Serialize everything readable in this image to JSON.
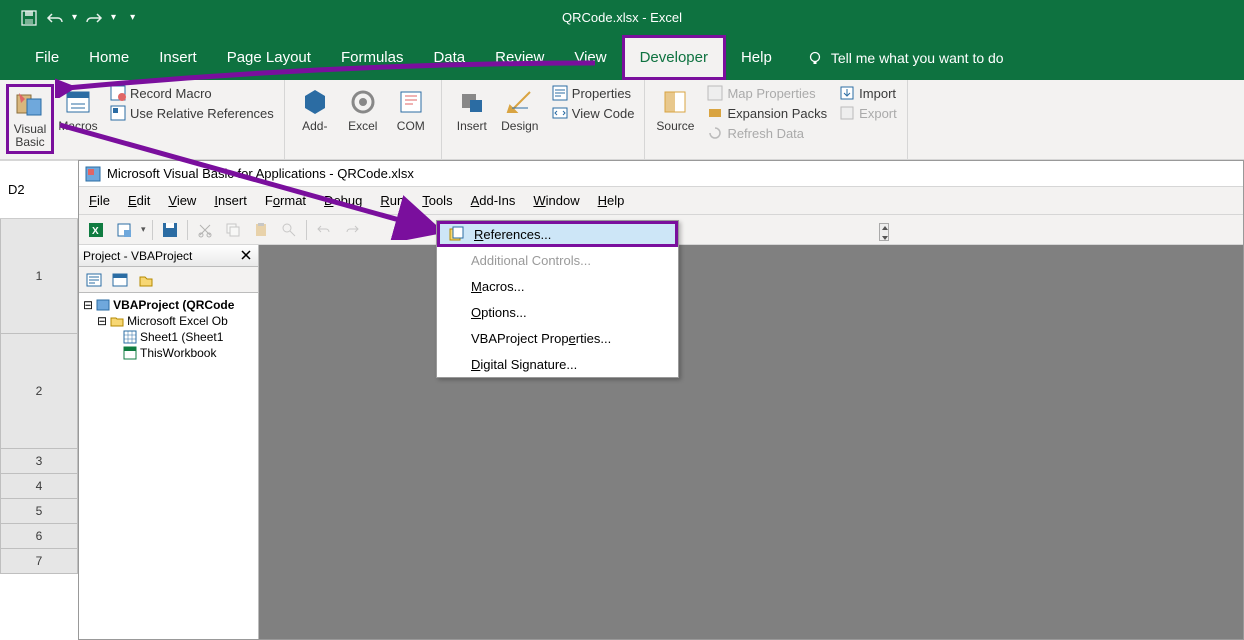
{
  "app": {
    "title": "QRCode.xlsx  -  Excel",
    "cell_ref": "D2"
  },
  "qat": {
    "save": "save",
    "undo": "undo",
    "redo": "redo"
  },
  "tabs": [
    "File",
    "Home",
    "Insert",
    "Page Layout",
    "Formulas",
    "Data",
    "Review",
    "View",
    "Developer",
    "Help"
  ],
  "tellme": "Tell me what you want to do",
  "ribbon": {
    "vb_label": "Visual\nBasic",
    "macros_label": "Macros",
    "record_macro": "Record Macro",
    "use_relative": "Use Relative References",
    "addins": "Add-",
    "excel_addins": "Excel",
    "com_addins": "COM",
    "insert": "Insert",
    "design": "Design",
    "properties": "Properties",
    "view_code": "View Code",
    "source": "Source",
    "map_props": "Map Properties",
    "expansion": "Expansion Packs",
    "refresh": "Refresh Data",
    "import": "Import",
    "export": "Export"
  },
  "vba": {
    "title": "Microsoft Visual Basic for Applications - QRCode.xlsx",
    "menu": [
      "File",
      "Edit",
      "View",
      "Insert",
      "Format",
      "Debug",
      "Run",
      "Tools",
      "Add-Ins",
      "Window",
      "Help"
    ],
    "project_pane_title": "Project - VBAProject",
    "tree": {
      "root": "VBAProject (QRCode",
      "excel_objects": "Microsoft Excel Ob",
      "sheet1": "Sheet1 (Sheet1",
      "thisworkbook": "ThisWorkbook"
    },
    "tools_menu": {
      "references": "References...",
      "additional": "Additional Controls...",
      "macros": "Macros...",
      "options": "Options...",
      "vbaproject_props": "VBAProject Properties...",
      "digital_sig": "Digital Signature..."
    }
  },
  "row_numbers": [
    "1",
    "2",
    "3",
    "4",
    "5",
    "6",
    "7"
  ]
}
